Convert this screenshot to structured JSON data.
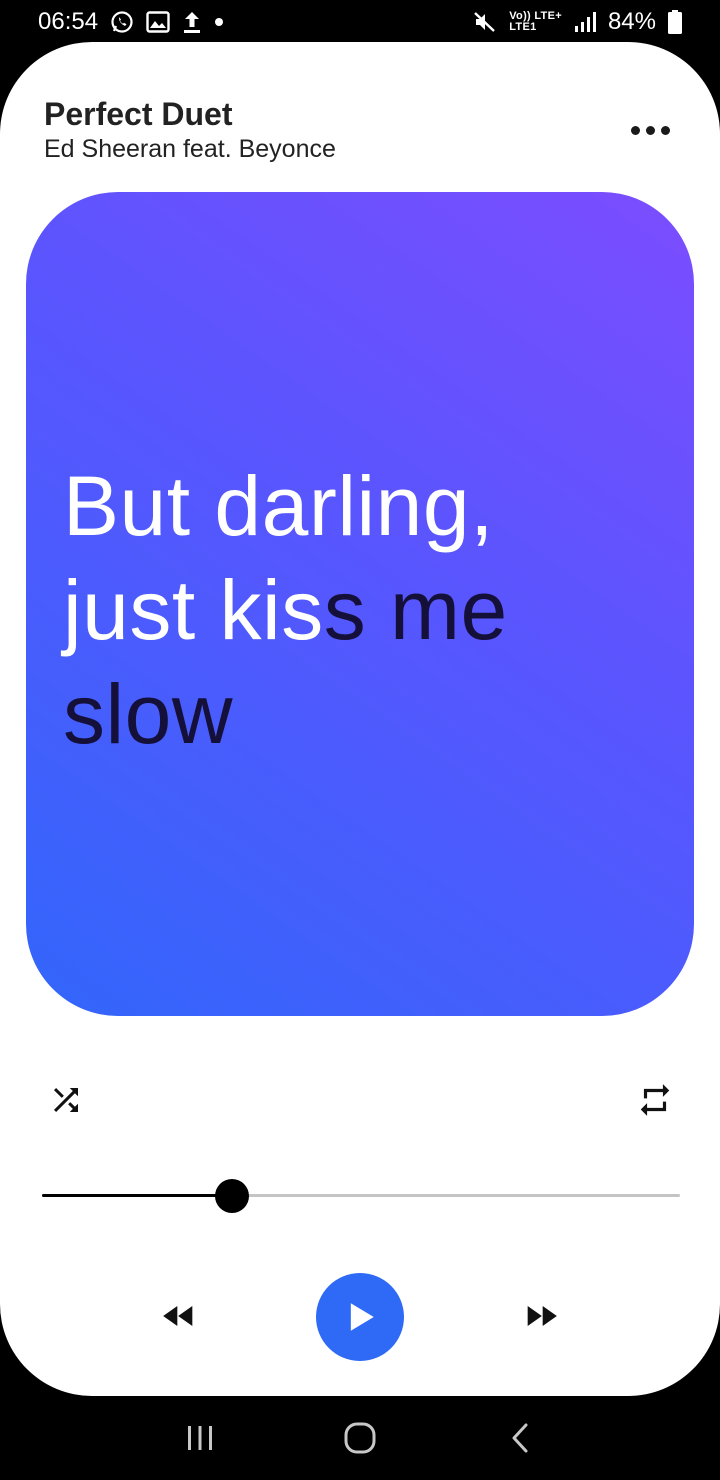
{
  "status_bar": {
    "time": "06:54",
    "battery": "84%",
    "network_top": "Vo)) LTE+",
    "network_bottom": "LTE1",
    "left_icons": [
      "whatsapp-icon",
      "gallery-icon",
      "upload-icon",
      "dot-icon"
    ],
    "right_icons": [
      "mute-icon",
      "signal-icon",
      "battery-icon"
    ]
  },
  "player": {
    "title": "Perfect Duet",
    "artist": "Ed Sheeran feat. Beyonce",
    "more_icon": "more-horizontal-icon"
  },
  "lyrics": {
    "sung_part_1": "But darling,",
    "sung_part_2": "just kis",
    "unsung_part_2": "s me",
    "unsung_part_3": "slow",
    "gradient": [
      "#7c4dff",
      "#3266fb"
    ],
    "sung_color": "#ffffff",
    "unsung_color": "#15103a"
  },
  "controls": {
    "shuffle_icon": "shuffle-icon",
    "repeat_icon": "repeat-icon",
    "rewind_icon": "rewind-icon",
    "play_icon": "play-icon",
    "forward_icon": "fast-forward-icon",
    "progress_fraction": 0.298,
    "play_button_color": "#2f6af6"
  },
  "nav_bar": {
    "recents_icon": "recents-icon",
    "home_icon": "home-icon",
    "back_icon": "back-icon"
  }
}
